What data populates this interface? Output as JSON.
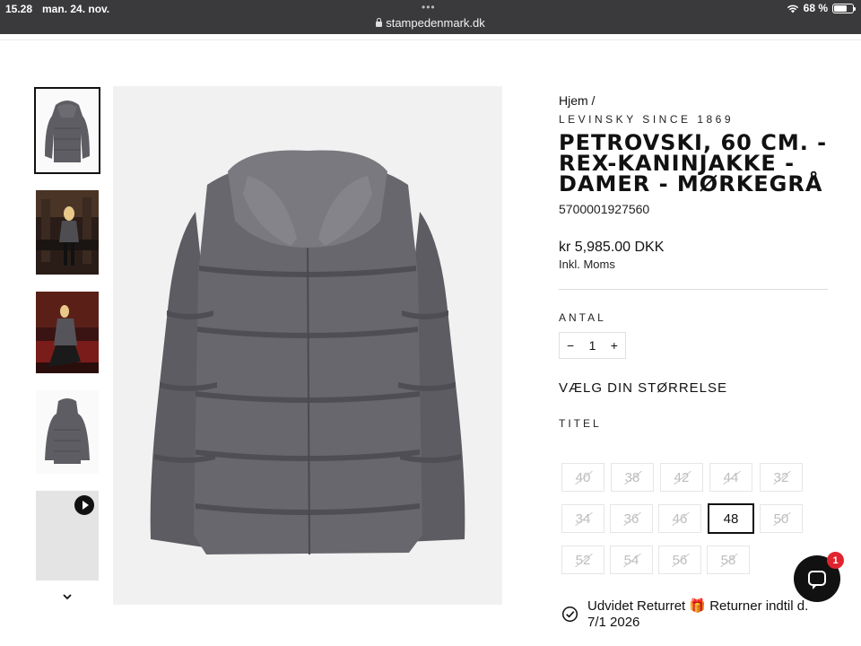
{
  "status_bar": {
    "time": "15.28",
    "date": "man. 24. nov.",
    "url": "stampedenmark.dk",
    "battery": "68 %",
    "battery_level": 0.68
  },
  "gallery": {
    "thumbnails": [
      {
        "name": "front",
        "active": true
      },
      {
        "name": "model-standing",
        "active": false
      },
      {
        "name": "model-sitting",
        "active": false
      },
      {
        "name": "back",
        "active": false
      },
      {
        "name": "video",
        "active": false
      }
    ]
  },
  "product": {
    "breadcrumb": "Hjem /",
    "vendor": "LEVINSKY SINCE 1869",
    "title": "PETROVSKI, 60 CM. - REX-KANINJAKKE - DAMER - MØRKEGRÅ",
    "sku": "5700001927560",
    "price": "kr 5,985.00 DKK",
    "tax_note": "Inkl. Moms",
    "quantity_label": "ANTAL",
    "quantity": "1",
    "minus": "−",
    "plus": "+",
    "size_heading": "VÆLG DIN STØRRELSE",
    "option_label": "TITEL",
    "sizes": [
      {
        "label": "40",
        "state": "disabled"
      },
      {
        "label": "38",
        "state": "disabled"
      },
      {
        "label": "42",
        "state": "disabled"
      },
      {
        "label": "44",
        "state": "disabled"
      },
      {
        "label": "32",
        "state": "disabled"
      },
      {
        "label": "34",
        "state": "disabled"
      },
      {
        "label": "36",
        "state": "disabled"
      },
      {
        "label": "46",
        "state": "disabled"
      },
      {
        "label": "48",
        "state": "selected"
      },
      {
        "label": "50",
        "state": "disabled"
      },
      {
        "label": "52",
        "state": "disabled"
      },
      {
        "label": "54",
        "state": "disabled"
      },
      {
        "label": "56",
        "state": "disabled"
      },
      {
        "label": "58",
        "state": "disabled"
      }
    ],
    "return_text": "Udvidet Returret 🎁 Returner indtil d. 7/1 2026"
  },
  "chat": {
    "badge": "1"
  }
}
